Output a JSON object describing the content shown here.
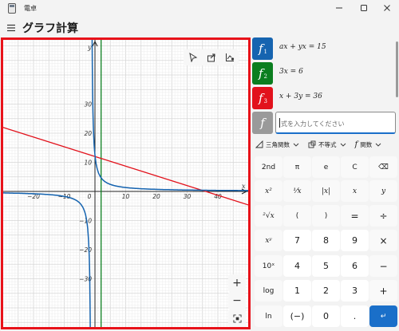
{
  "window": {
    "title": "電卓",
    "controls": [
      "minimize",
      "maximize",
      "close"
    ]
  },
  "header": {
    "title": "グラフ計算"
  },
  "graph": {
    "x_ticks": [
      "−20",
      "−10",
      "0",
      "10",
      "20",
      "30",
      "40"
    ],
    "y_ticks": [
      "30",
      "20",
      "10",
      "−10",
      "−20",
      "−30"
    ],
    "x_axis_label": "x",
    "y_axis_label": "y",
    "tools": [
      "cursor-icon",
      "share-icon",
      "graph-options-icon"
    ],
    "zoom": {
      "in": "+",
      "out": "−"
    }
  },
  "functions": [
    {
      "label": "f",
      "index": "1",
      "expr": "ax + yx = 15",
      "color": "#1664b0"
    },
    {
      "label": "f",
      "index": "2",
      "expr": "3x = 6",
      "color": "#0b7e1f"
    },
    {
      "label": "f",
      "index": "3",
      "expr": "x + 3y = 36",
      "color": "#e2121c"
    }
  ],
  "new_function": {
    "label": "f",
    "placeholder": "式を入力してください",
    "color": "#9a9a9a"
  },
  "toolbar": {
    "trig": "三角関数",
    "inequality": "不等式",
    "functions": "関数"
  },
  "keypad": {
    "rows": [
      [
        "2nd",
        "π",
        "e",
        "C",
        "⌫"
      ],
      [
        "x²",
        "¹⁄x",
        "|x|",
        "x",
        "y"
      ],
      [
        "²√x",
        "(",
        ")",
        "=",
        "÷"
      ],
      [
        "xʸ",
        "7",
        "8",
        "9",
        "×"
      ],
      [
        "10ˣ",
        "4",
        "5",
        "6",
        "−"
      ],
      [
        "log",
        "1",
        "2",
        "3",
        "+"
      ],
      [
        "ln",
        "(−)",
        "0",
        ".",
        "↵"
      ]
    ]
  },
  "colors": {
    "accent": "#1a6fc9",
    "frame_highlight": "#e8121a"
  }
}
